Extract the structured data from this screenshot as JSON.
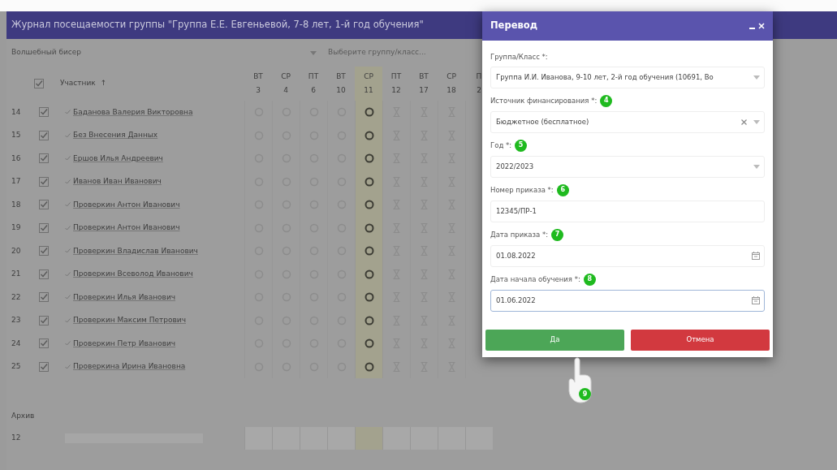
{
  "journal": {
    "title": "Журнал посещаемости группы \"Группа Е.Е. Евгеньевой, 7-8 лет, 1-й год обучения\"",
    "filters": [
      {
        "kind": "select",
        "value": "Волшебный бисер"
      },
      {
        "kind": "input",
        "placeholder": "Выберите группу/класс..."
      }
    ],
    "participant_header": "Участник",
    "sort_mark": "↑",
    "header_checked": true,
    "columns": [
      {
        "day": "ВТ",
        "date": "3",
        "kind": "past"
      },
      {
        "day": "СР",
        "date": "4",
        "kind": "past"
      },
      {
        "day": "ПТ",
        "date": "6",
        "kind": "past"
      },
      {
        "day": "ВТ",
        "date": "10",
        "kind": "past"
      },
      {
        "day": "СР",
        "date": "11",
        "kind": "today"
      },
      {
        "day": "ПТ",
        "date": "12",
        "kind": "future"
      },
      {
        "day": "ВТ",
        "date": "17",
        "kind": "future"
      },
      {
        "day": "СР",
        "date": "18",
        "kind": "future"
      },
      {
        "day": "П",
        "date": "2"
      }
    ],
    "rows": [
      {
        "number": "14",
        "checked": true,
        "name": "Баданова Валерия Викторовна"
      },
      {
        "number": "15",
        "checked": true,
        "name": "Без Внесения Данных"
      },
      {
        "number": "16",
        "checked": true,
        "name": "Ершов Илья Андреевич"
      },
      {
        "number": "17",
        "checked": true,
        "name": "Иванов Иван Иванович"
      },
      {
        "number": "18",
        "checked": true,
        "name": "Проверкин Антон Иванович"
      },
      {
        "number": "19",
        "checked": true,
        "name": "Проверкин Антон Иванович"
      },
      {
        "number": "20",
        "checked": true,
        "name": "Проверкин Владислав Иванович"
      },
      {
        "number": "21",
        "checked": true,
        "name": "Проверкин Всеволод Иванович"
      },
      {
        "number": "22",
        "checked": true,
        "name": "Проверкин Илья Иванович"
      },
      {
        "number": "23",
        "checked": true,
        "name": "Проверкин Максим Петрович"
      },
      {
        "number": "24",
        "checked": true,
        "name": "Проверкин Петр Иванович"
      },
      {
        "number": "25",
        "checked": true,
        "name": "Проверкина Ирина Ивановна"
      }
    ],
    "archive": {
      "title": "Архив",
      "rows": [
        {
          "number": "12"
        }
      ]
    }
  },
  "dialog": {
    "title": "Перевод",
    "fields": [
      {
        "label": "Группа/Класс *:",
        "kind": "select",
        "value": "Группа И.И. Иванова, 9-10 лет, 2-й год обучения (10691, Во",
        "clearable": false,
        "focused": false
      },
      {
        "label": "Источник финансирования *:",
        "step": "4",
        "kind": "select",
        "value": "Бюджетное (бесплатное)",
        "clearable": true,
        "focused": false
      },
      {
        "label": "Год *:",
        "step": "5",
        "kind": "select",
        "value": "2022/2023",
        "clearable": false,
        "focused": false
      },
      {
        "label": "Номер приказа *:",
        "step": "6",
        "kind": "text",
        "value": "12345/ПР-1",
        "clearable": false,
        "focused": false
      },
      {
        "label": "Дата приказа *:",
        "step": "7",
        "kind": "date",
        "value": "01.08.2022",
        "clearable": false,
        "focused": false
      },
      {
        "label": "Дата начала обучения *:",
        "step": "8",
        "kind": "date",
        "value": "01.06.2022",
        "clearable": false,
        "focused": true
      }
    ],
    "buttons": [
      {
        "label": "Да",
        "kind": "confirm"
      },
      {
        "label": "Отмена",
        "kind": "cancel"
      }
    ],
    "cursor_step": "9"
  }
}
